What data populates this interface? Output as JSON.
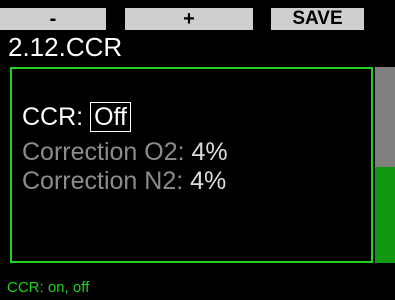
{
  "softkeys": {
    "left_label": "-",
    "middle_label": "+",
    "right_label": "SAVE"
  },
  "header": {
    "title": "2.12.CCR"
  },
  "settings": [
    {
      "label": "CCR:",
      "value": "Off"
    },
    {
      "label": "Correction O2:",
      "value": "4%"
    },
    {
      "label": "Correction N2:",
      "value": "4%"
    }
  ],
  "footer": {
    "hint": "CCR: on, off"
  },
  "colors": {
    "accent": "#1fd21f",
    "softkey_bg": "#cfcfcf",
    "scroll_thumb": "#808080",
    "scroll_lower": "#119a11",
    "inactive_text": "#8c8c8c"
  }
}
